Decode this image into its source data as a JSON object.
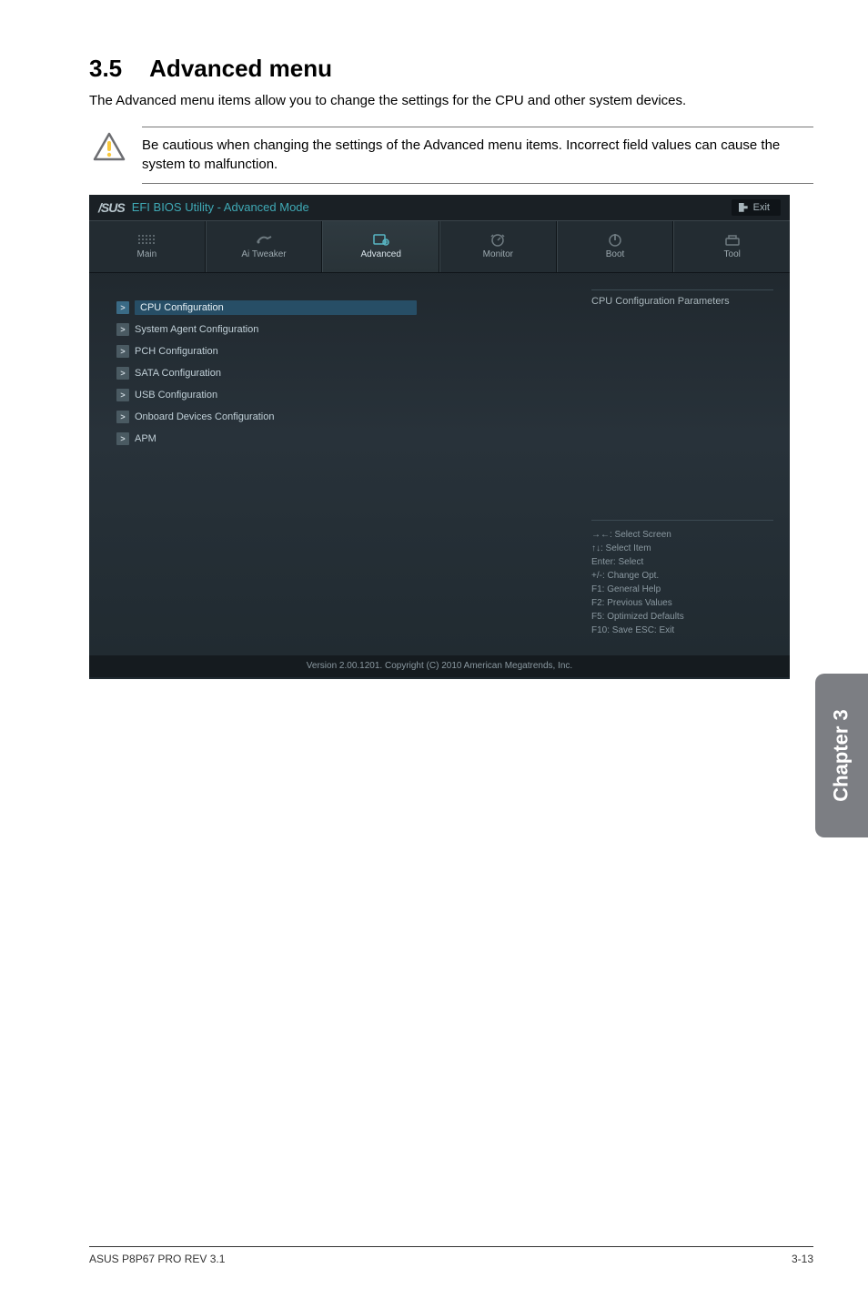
{
  "heading": {
    "num": "3.5",
    "title": "Advanced menu"
  },
  "intro": "The Advanced menu items allow you to change the settings for the CPU and other system devices.",
  "warning": "Be cautious when changing the settings of the Advanced menu items. Incorrect field values can cause the system to malfunction.",
  "bios": {
    "logo": "/SUS",
    "title": "EFI BIOS Utility - Advanced Mode",
    "exit": "Exit",
    "tabs": [
      {
        "label": "Main"
      },
      {
        "label": "Ai  Tweaker"
      },
      {
        "label": "Advanced"
      },
      {
        "label": "Monitor"
      },
      {
        "label": "Boot"
      },
      {
        "label": "Tool"
      }
    ],
    "menu": [
      {
        "label": "CPU Configuration",
        "selected": true
      },
      {
        "label": "System Agent Configuration"
      },
      {
        "label": "PCH Configuration"
      },
      {
        "label": "SATA Configuration"
      },
      {
        "label": "USB Configuration"
      },
      {
        "label": "Onboard Devices Configuration"
      },
      {
        "label": "APM"
      }
    ],
    "helpTitle": "CPU Configuration Parameters",
    "hints": "→←:  Select Screen\n↑↓:  Select Item\nEnter:  Select\n+/-:  Change Opt.\nF1:  General Help\nF2:  Previous Values\nF5:  Optimized Defaults\nF10:  Save   ESC:  Exit",
    "footerVersion": "Version  2.00.1201.   Copyright  (C)  2010  American  Megatrends,  Inc."
  },
  "sideTab": "Chapter 3",
  "footer": {
    "left": "ASUS P8P67 PRO REV 3.1",
    "right": "3-13"
  }
}
